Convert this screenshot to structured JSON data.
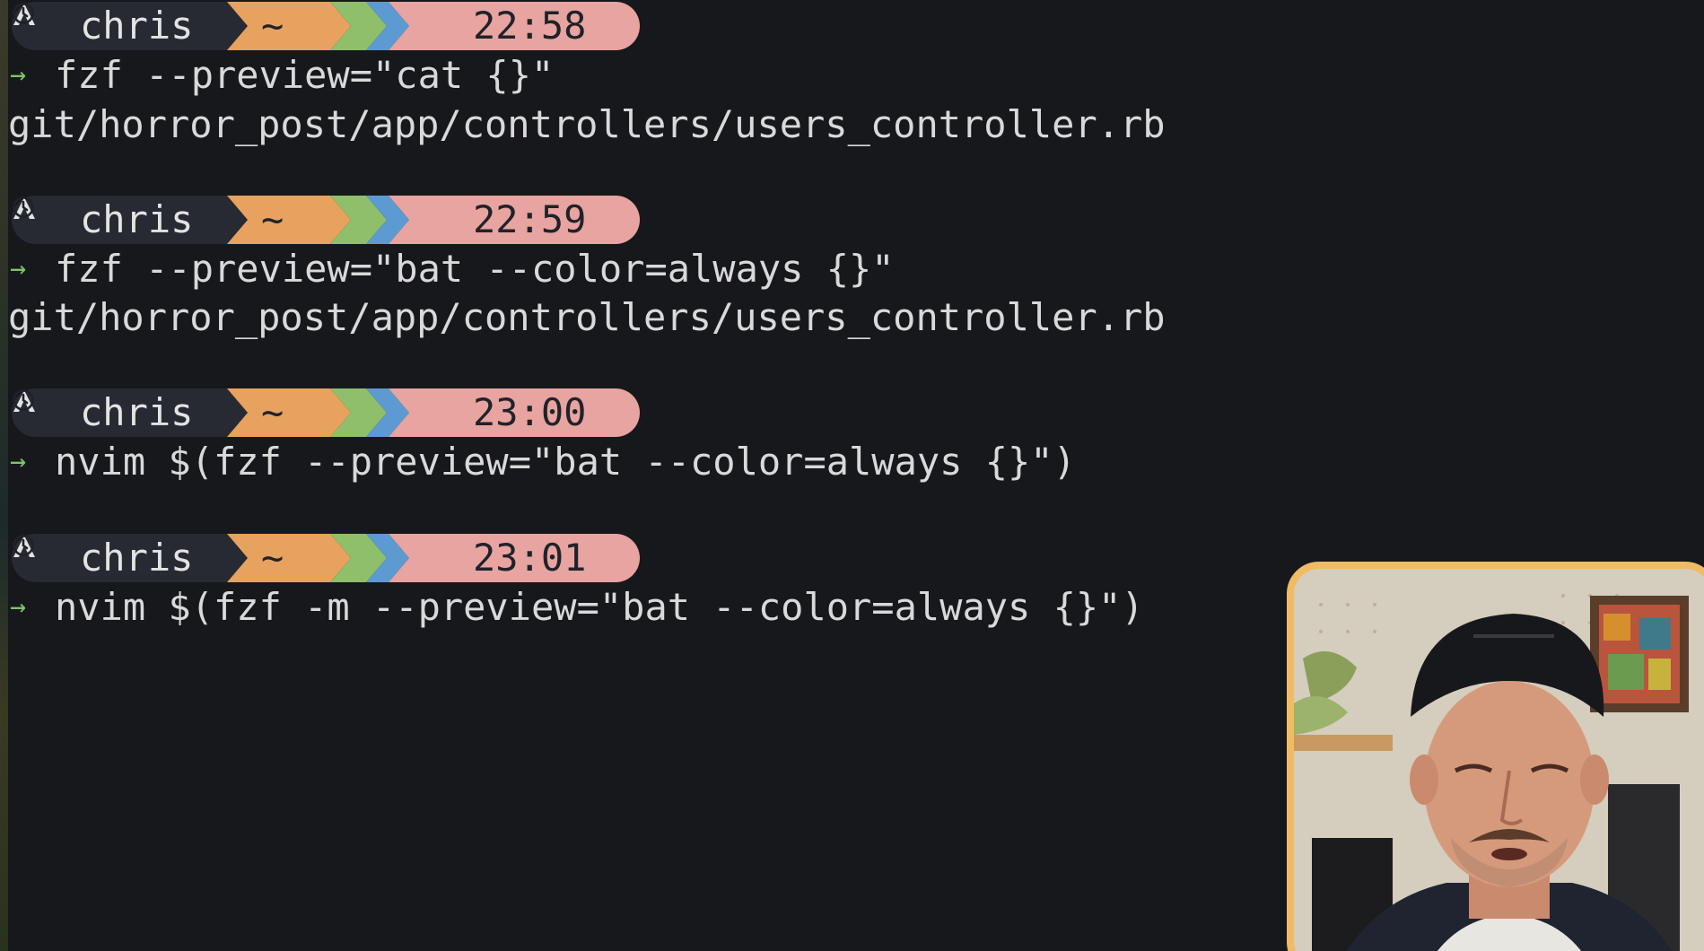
{
  "theme": {
    "background": "#17181c",
    "text": "#d9d9d9",
    "user_segment": "#272a33",
    "home_segment": "#e7a25f",
    "green_segment": "#8fbf6a",
    "blue_segment": "#5d9ad2",
    "time_segment": "#e8a4a0",
    "arrow": "#7fc36a",
    "webcam_border": "#f0bb63"
  },
  "prompts": [
    {
      "icon": "arch-icon",
      "user": "chris",
      "dir": "~",
      "clock_icon": "clock-icon",
      "time": "22:58",
      "arrow": "→",
      "command": "fzf --preview=\"cat {}\"",
      "output": "git/horror_post/app/controllers/users_controller.rb"
    },
    {
      "icon": "arch-icon",
      "user": "chris",
      "dir": "~",
      "clock_icon": "clock-icon",
      "time": "22:59",
      "arrow": "→",
      "command": "fzf --preview=\"bat --color=always {}\"",
      "output": "git/horror_post/app/controllers/users_controller.rb"
    },
    {
      "icon": "arch-icon",
      "user": "chris",
      "dir": "~",
      "clock_icon": "clock-icon",
      "time": "23:00",
      "arrow": "→",
      "command": "nvim $(fzf --preview=\"bat --color=always {}\")"
    },
    {
      "icon": "arch-icon",
      "user": "chris",
      "dir": "~",
      "clock_icon": "clock-icon",
      "time": "23:01",
      "arrow": "→",
      "command": "nvim $(fzf -m --preview=\"bat --color=always {}\")"
    }
  ],
  "webcam": {
    "icon": "presenter-video"
  }
}
